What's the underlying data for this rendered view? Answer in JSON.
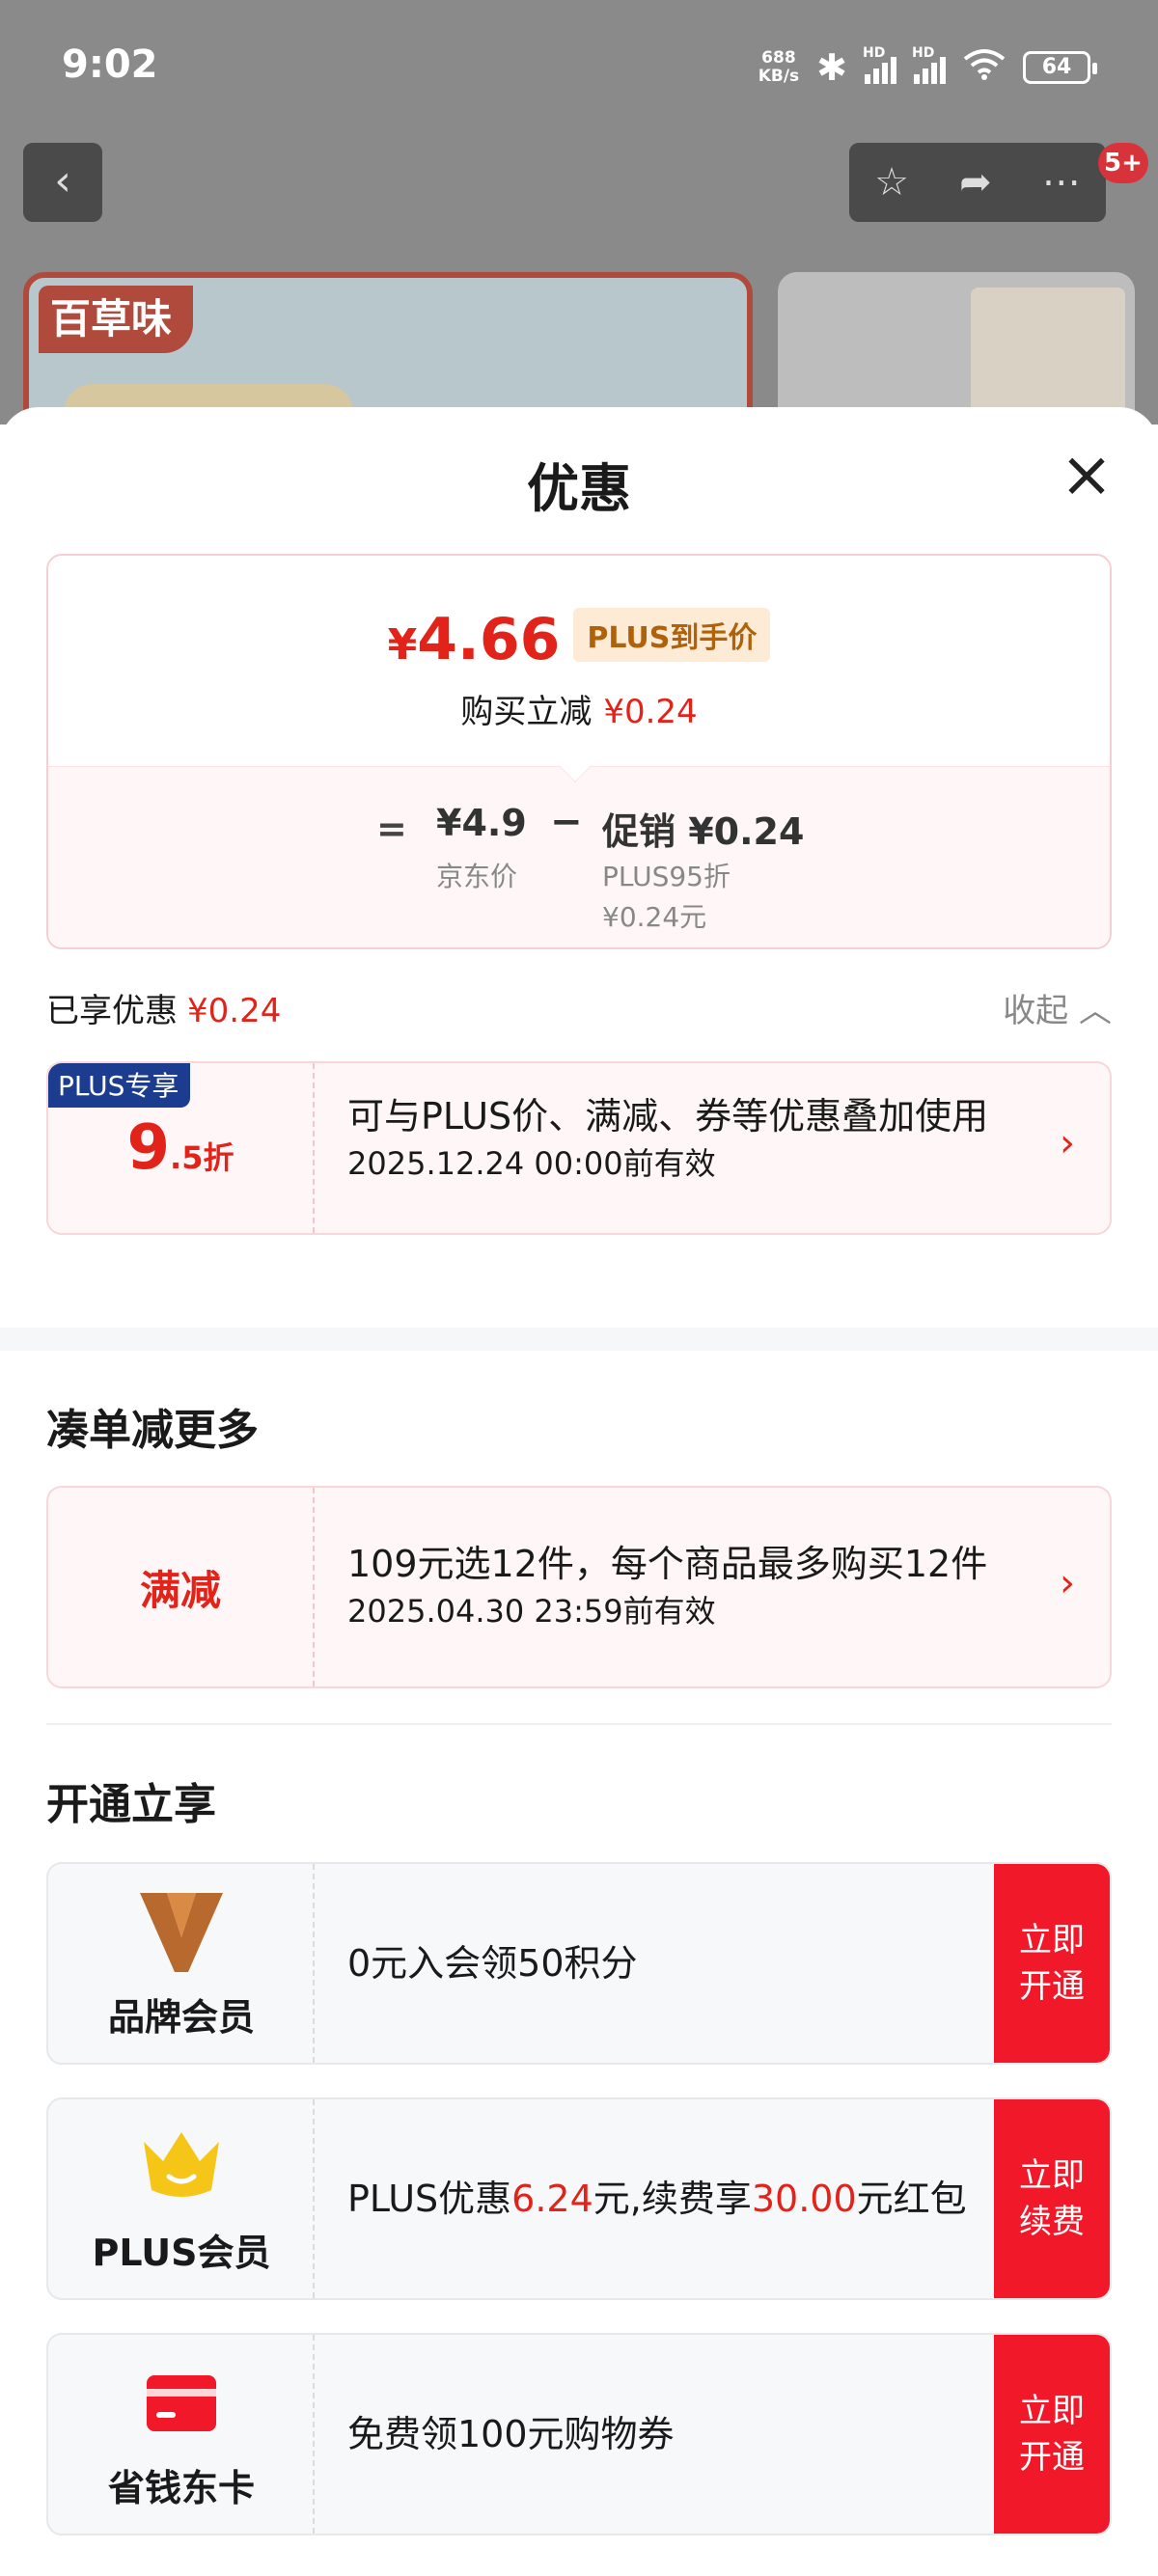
{
  "status": {
    "time": "9:02",
    "speed_value": "688",
    "speed_unit": "KB/s",
    "signal_label": "HD",
    "battery": "64"
  },
  "header": {
    "cart_badge": "5+"
  },
  "background_product": {
    "brand": "百草味"
  },
  "sheet": {
    "title": "优惠",
    "price_summary": {
      "currency": "¥",
      "final_price": "4.66",
      "price_tag": "PLUS到手价",
      "reduce_label": "购买立减",
      "reduce_value": "¥0.24",
      "equals": "=",
      "jd_price": "¥4.9",
      "jd_label": "京东价",
      "minus": "−",
      "promo": "促销 ¥0.24",
      "promo_detail_1": "PLUS95折",
      "promo_detail_2": "¥0.24元"
    },
    "enjoyed": {
      "label": "已享优惠",
      "value": "¥0.24",
      "collapse": "收起 ︿"
    },
    "plus_coupon": {
      "badge": "PLUS专享",
      "discount_big": "9",
      "discount_small": ".5折",
      "desc": "可与PLUS价、满减、券等优惠叠加使用",
      "valid": "2025.12.24 00:00前有效",
      "arrow": "›"
    },
    "more_section": {
      "title": "凑单减更多",
      "coupon": {
        "label": "满减",
        "desc": "109元选12件，每个商品最多购买12件",
        "valid": "2025.04.30 23:59前有效",
        "arrow": "›"
      }
    },
    "open_section": {
      "title": "开通立享",
      "members": [
        {
          "name": "品牌会员",
          "desc": "0元入会领50积分",
          "cta": "立即开通"
        },
        {
          "name": "PLUS会员",
          "desc_pre": "PLUS优惠",
          "desc_val1": "6.24",
          "desc_mid": "元,续费享",
          "desc_val2": "30.00",
          "desc_post": "元红包",
          "cta": "立即续费"
        },
        {
          "name": "省钱东卡",
          "desc": "免费领100元购物券",
          "cta": "立即开通"
        }
      ]
    }
  },
  "colors": {
    "accent_red": "#e2231a",
    "cta_red": "#f1182a",
    "plus_blue": "#1c3d8f"
  }
}
